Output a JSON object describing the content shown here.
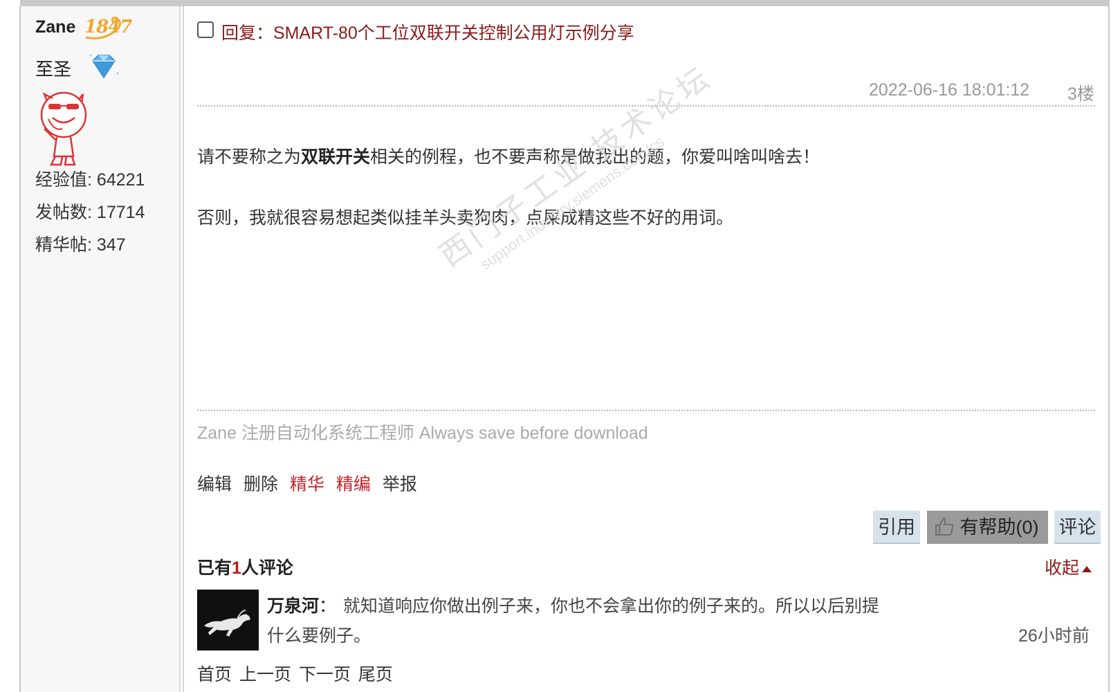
{
  "user": {
    "name": "Zane",
    "level_number": "1847",
    "rank_title": "至圣",
    "stats": [
      {
        "label": "经验值",
        "value": "64221"
      },
      {
        "label": "发帖数",
        "value": "17714"
      },
      {
        "label": "精华帖",
        "value": "347"
      }
    ]
  },
  "post": {
    "title": "回复：SMART-80个工位双联开关控制公用灯示例分享",
    "timestamp": "2022-06-16 18:01:12",
    "floor": "3楼",
    "body": {
      "p1_before": "请不要称之为",
      "p1_bold": "双联开关",
      "p1_after": "相关的例程，也不要声称是做我出的题，你爱叫啥叫啥去！",
      "p2": "否则，我就很容易想起类似挂羊头卖狗肉，点屎成精这些不好的用词。"
    },
    "watermark": {
      "line1": "西门子工业 技术论坛",
      "line2": "support.industry.siemens.com/cs"
    },
    "signature": "Zane 注册自动化系统工程师 Always save before download",
    "actions": {
      "edit": "编辑",
      "delete": "删除",
      "essence": "精华",
      "edit_pick": "精编",
      "report": "举报"
    },
    "buttons": {
      "quote": "引用",
      "helpful": "有帮助(0)",
      "comment": "评论"
    }
  },
  "comments": {
    "prefix": "已有",
    "count": "1",
    "suffix": "人评论",
    "collapse": "收起",
    "items": [
      {
        "author": "万泉河",
        "separator": "：",
        "line1": "就知道响应你做出例子来，你也不会拿出你的例子来的。所以以后别提",
        "line2": "什么要例子。",
        "time": "26小时前"
      }
    ]
  },
  "pager": {
    "first": "首页",
    "prev": "上一页",
    "next": "下一页",
    "last": "尾页"
  },
  "colors": {
    "title_red": "#8b1a1a",
    "action_red": "#c1272d",
    "button_blue": "#d7e3ec",
    "button_gray": "#9a9a9a"
  }
}
